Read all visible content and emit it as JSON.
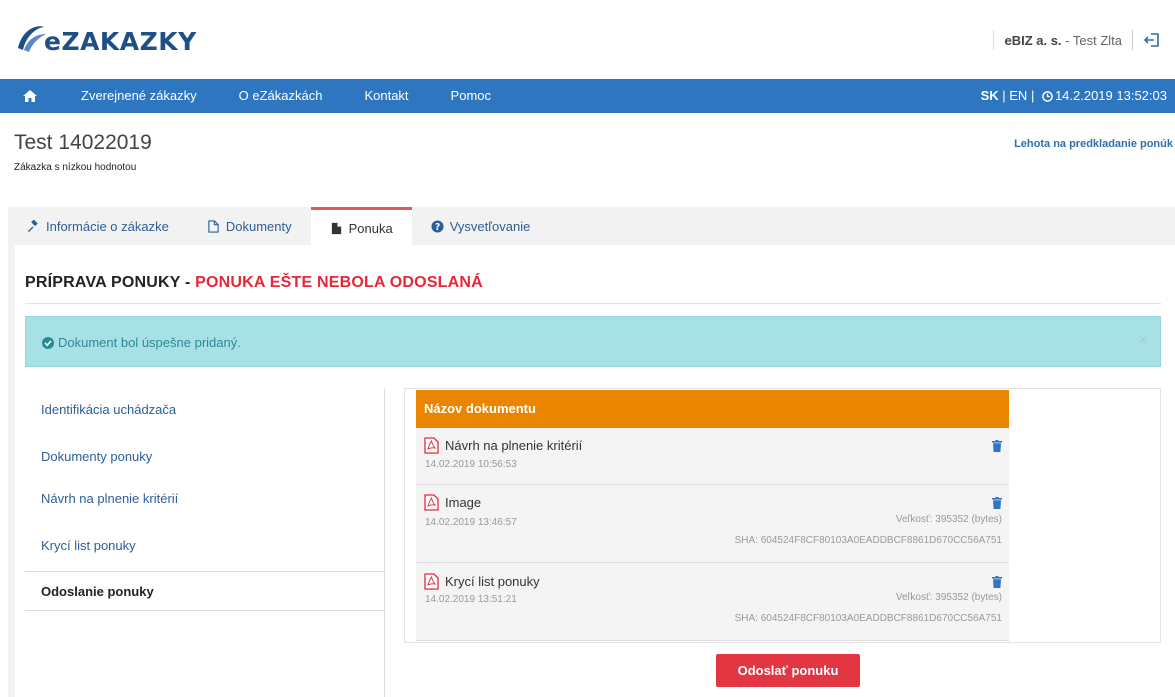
{
  "header": {
    "logo_text": "eZAKAZKY",
    "company": "eBIZ a. s.",
    "user_suffix": " - Test Zlta"
  },
  "nav": {
    "items": [
      "Zverejnené zákazky",
      "O eZákazkách",
      "Kontakt",
      "Pomoc"
    ],
    "lang_active": "SK",
    "lang_sep": " | ",
    "lang_other": "EN",
    "lang_sep2": " | ",
    "datetime": "14.2.2019 13:52:03"
  },
  "page": {
    "title": "Test 14022019",
    "subtitle": "Zákazka s nízkou hodnotou",
    "deadline_link": "Lehota na predkladanie ponúk"
  },
  "tabs": [
    {
      "label": "Informácie o zákazke",
      "icon": "gavel-icon"
    },
    {
      "label": "Dokumenty",
      "icon": "file-icon"
    },
    {
      "label": "Ponuka",
      "icon": "file-filled-icon",
      "active": true
    },
    {
      "label": "Vysvetľovanie",
      "icon": "question-circle-icon"
    }
  ],
  "section": {
    "title_prefix": "PRÍPRAVA PONUKY - ",
    "title_status": "PONUKA EŠTE NEBOLA ODOSLANÁ"
  },
  "alert": {
    "text": "Dokument bol úspešne pridaný.",
    "close": "×"
  },
  "side_menu": [
    {
      "label": "Identifikácia uchádzača"
    },
    {
      "label": "Dokumenty ponuky"
    },
    {
      "label": "Návrh na plnenie kritérií"
    },
    {
      "label": "Krycí list ponuky"
    },
    {
      "label": "Odoslanie ponuky",
      "active": true
    }
  ],
  "documents": {
    "header": "Názov dokumentu",
    "rows": [
      {
        "name": "Návrh na plnenie kritérií",
        "date": "14.02.2019 10:56:53",
        "size": "",
        "sha": ""
      },
      {
        "name": "Image",
        "date": "14.02.2019 13:46:57",
        "size": "Veľkosť: 395352 (bytes)",
        "sha": "SHA: 604524F8CF80103A0EADDBCF8861D670CC56A751"
      },
      {
        "name": "Krycí list ponuky",
        "date": "14.02.2019 13:51:21",
        "size": "Veľkosť: 395352 (bytes)",
        "sha": "SHA: 604524F8CF80103A0EADDBCF8861D670CC56A751"
      }
    ]
  },
  "actions": {
    "send": "Odoslať ponuku"
  },
  "colors": {
    "navbar": "#2f76c0",
    "tab_active_border": "#e05a5a",
    "status_red": "#e4283a",
    "table_header": "#ea8500",
    "alert_bg": "#a7e1e6",
    "send_button": "#e23743"
  }
}
